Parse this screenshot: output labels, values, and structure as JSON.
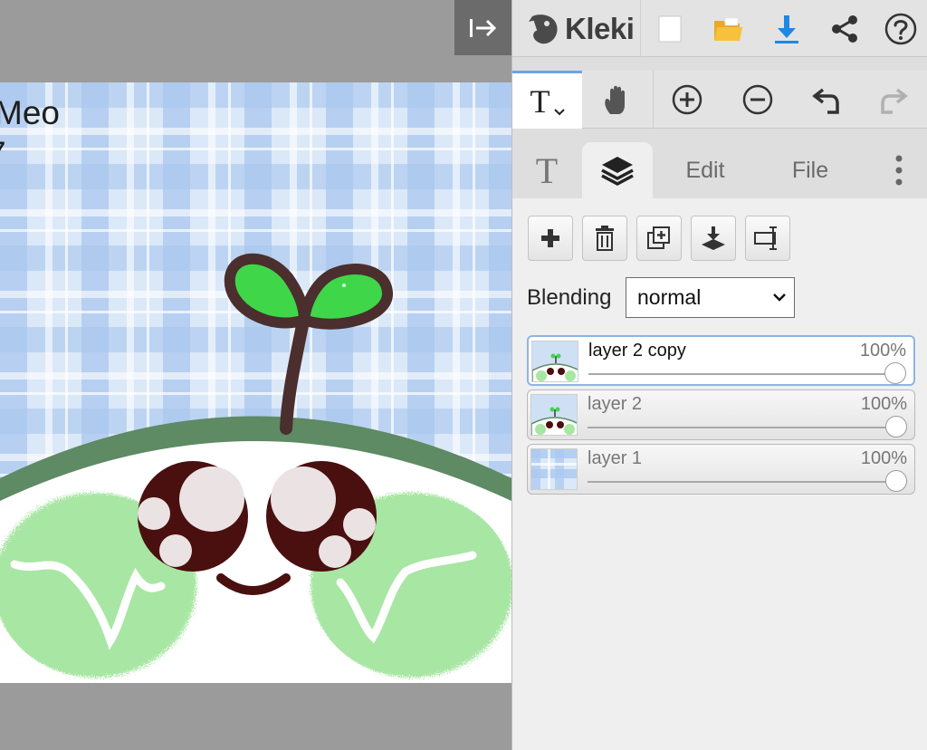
{
  "app": {
    "name": "Kleki"
  },
  "colors": {
    "accent_blue": "#1e88e5",
    "folder_yellow": "#f6c13d",
    "panel_bg": "#dedede",
    "active_tab": "#6aa3e8"
  },
  "canvas": {
    "text_line1": "Meo",
    "text_line2": "7"
  },
  "topbar": {
    "icons": [
      "kleki-logo-icon",
      "new-document-icon",
      "open-folder-icon",
      "download-icon",
      "share-icon",
      "help-icon"
    ]
  },
  "toolbar": {
    "active_tool": "text",
    "active_tool_glyph": "T",
    "tools": [
      "text-tool-icon",
      "hand-icon",
      "zoom-in-icon",
      "zoom-out-icon",
      "undo-icon",
      "redo-icon"
    ]
  },
  "tabs": {
    "text_glyph": "T",
    "edit_label": "Edit",
    "file_label": "File",
    "active": "layers"
  },
  "layers_panel": {
    "actions": [
      "add-layer",
      "delete-layer",
      "duplicate-layer",
      "merge-down",
      "rename-layer"
    ],
    "blending_label": "Blending",
    "blending_value": "normal",
    "layers": [
      {
        "name": "layer 2 copy",
        "opacity": "100%",
        "opacity_value": 1.0,
        "active": true
      },
      {
        "name": "layer 2",
        "opacity": "100%",
        "opacity_value": 1.0,
        "active": false
      },
      {
        "name": "layer 1",
        "opacity": "100%",
        "opacity_value": 1.0,
        "active": false
      }
    ]
  }
}
